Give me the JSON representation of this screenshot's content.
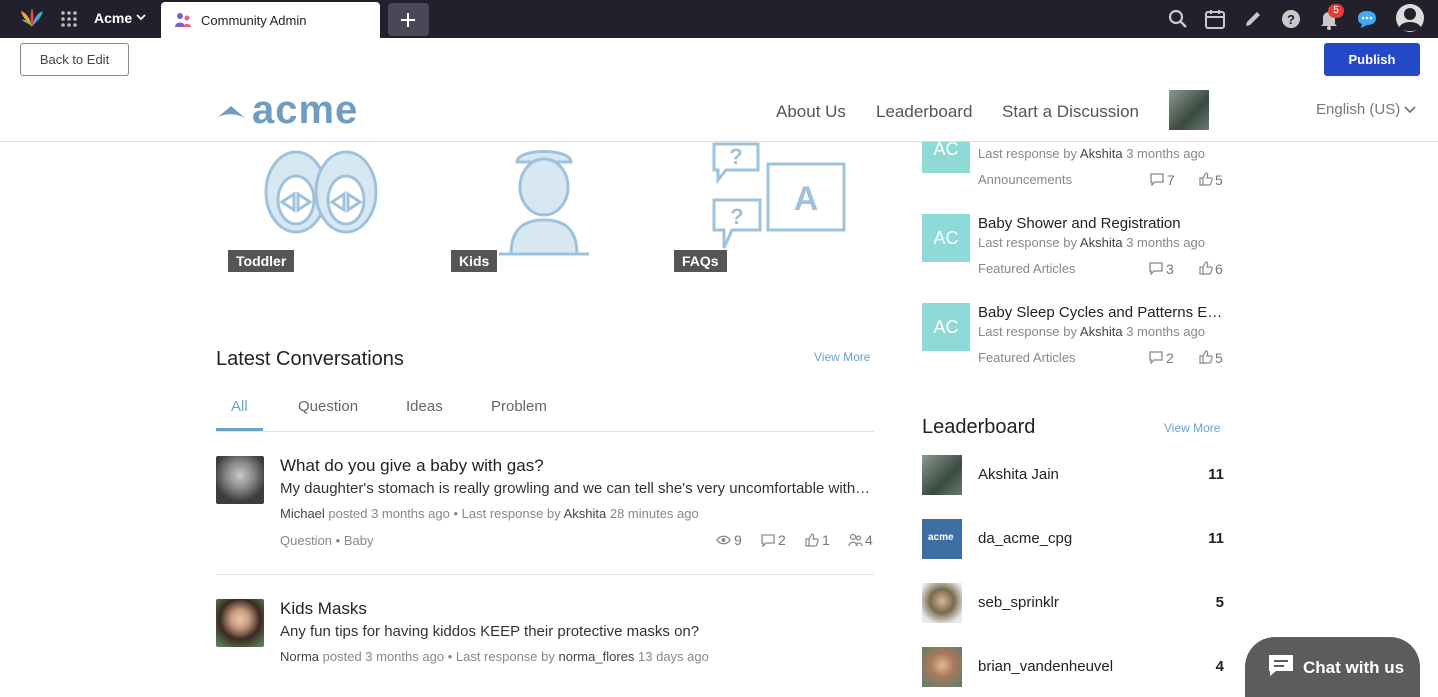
{
  "topbar": {
    "brand": "Acme",
    "tab_title": "Community Admin",
    "notification_count": "5"
  },
  "editbar": {
    "back_label": "Back to Edit",
    "publish_label": "Publish"
  },
  "site_header": {
    "logo_text": "acme",
    "nav": [
      "About Us",
      "Leaderboard",
      "Start a Discussion"
    ],
    "language": "English (US)"
  },
  "categories": [
    "Toddler",
    "Kids",
    "FAQs"
  ],
  "latest": {
    "title": "Latest Conversations",
    "view_more": "View More",
    "tabs": [
      "All",
      "Question",
      "Ideas",
      "Problem"
    ],
    "items": [
      {
        "title": "What do you give a baby with gas?",
        "body": "My daughter's stomach is really growling and we can tell she's very uncomfortable with ga...",
        "author": "Michael",
        "posted": "posted 3 months ago",
        "sep": "•",
        "last_prefix": "Last response by",
        "last_user": "Akshita",
        "last_time": "28 minutes ago",
        "type": "Question",
        "category": "Baby",
        "views": "9",
        "comments": "2",
        "likes": "1",
        "followers": "4"
      },
      {
        "title": "Kids Masks",
        "body": "Any fun tips for having kiddos KEEP their protective masks on?",
        "author": "Norma",
        "posted": "posted 3 months ago",
        "sep": "•",
        "last_prefix": "Last response by",
        "last_user": "norma_flores",
        "last_time": "13 days ago"
      }
    ]
  },
  "recent": [
    {
      "initials": "AC",
      "title": "",
      "last_prefix": "Last response by",
      "last_user": "Akshita",
      "time": "3 months ago",
      "category": "Announcements",
      "comments": "7",
      "likes": "5"
    },
    {
      "initials": "AC",
      "title": "Baby Shower and Registration",
      "last_prefix": "Last response by",
      "last_user": "Akshita",
      "time": "3 months ago",
      "category": "Featured Articles",
      "comments": "3",
      "likes": "6"
    },
    {
      "initials": "AC",
      "title": "Baby Sleep Cycles and Patterns Exp...",
      "last_prefix": "Last response by",
      "last_user": "Akshita",
      "time": "3 months ago",
      "category": "Featured Articles",
      "comments": "2",
      "likes": "5"
    }
  ],
  "leaderboard": {
    "title": "Leaderboard",
    "view_more": "View More",
    "rows": [
      {
        "name": "Akshita Jain",
        "score": "11"
      },
      {
        "name": "da_acme_cpg",
        "score": "11",
        "avatar_text": "acme"
      },
      {
        "name": "seb_sprinklr",
        "score": "5"
      },
      {
        "name": "brian_vandenheuvel",
        "score": "4"
      }
    ]
  },
  "chat": {
    "label": "Chat with us"
  },
  "colors": {
    "accent": "#2348c8",
    "link": "#6aa3c8",
    "topbar": "#23202e",
    "avatar_bg": "#8fdad6"
  }
}
